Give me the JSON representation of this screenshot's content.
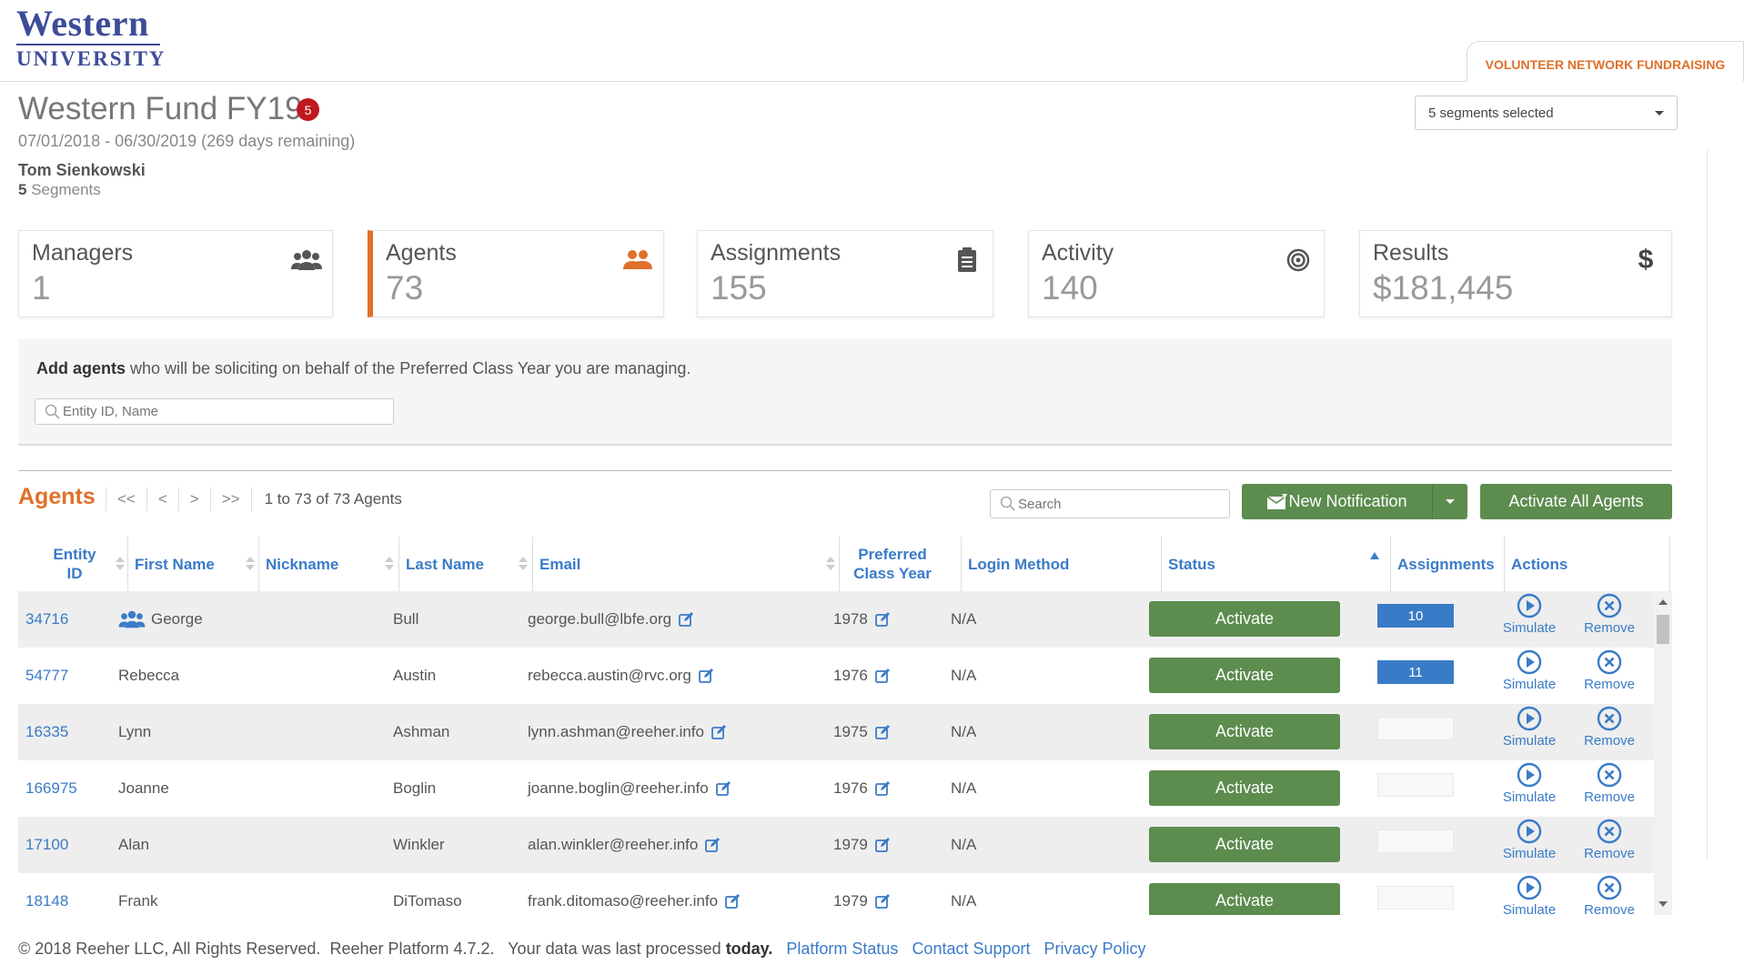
{
  "logo": {
    "top": "Western",
    "bottom": "UNIVERSITY"
  },
  "app_tab": "VOLUNTEER NETWORK FUNDRAISING",
  "fund": {
    "title": "Western Fund FY19",
    "badge": "5",
    "dates": "07/01/2018 - 06/30/2019 (269 days remaining)",
    "owner": "Tom Sienkowski",
    "segments_count": "5",
    "segments_label": "Segments"
  },
  "segments_select": {
    "value": "5 segments selected"
  },
  "cards": [
    {
      "label": "Managers",
      "value": "1",
      "icon": "managers-icon"
    },
    {
      "label": "Agents",
      "value": "73",
      "icon": "agents-icon"
    },
    {
      "label": "Assignments",
      "value": "155",
      "icon": "clipboard-icon"
    },
    {
      "label": "Activity",
      "value": "140",
      "icon": "target-icon"
    },
    {
      "label": "Results",
      "value": "$181,445",
      "icon": "dollar-icon"
    }
  ],
  "add_agents": {
    "bold": "Add agents",
    "text": " who will be soliciting on behalf of the Preferred Class Year you are managing.",
    "placeholder": "Entity ID, Name"
  },
  "agents_toolbar": {
    "title": "Agents",
    "first": "<<",
    "prev": "<",
    "next": ">",
    "last": ">>",
    "count_text": "1 to 73 of 73 Agents",
    "search_placeholder": "Search",
    "new_notification": "New Notification",
    "activate_all": "Activate All Agents"
  },
  "table": {
    "columns": {
      "entity_id_1": "Entity",
      "entity_id_2": "ID",
      "first_name": "First Name",
      "nickname": "Nickname",
      "last_name": "Last Name",
      "email": "Email",
      "pref_1": "Preferred",
      "pref_2": "Class Year",
      "login_method": "Login Method",
      "status": "Status",
      "assignments": "Assignments",
      "actions": "Actions"
    },
    "rows": [
      {
        "id": "34716",
        "first": "George",
        "nickname": "",
        "last": "Bull",
        "email": "george.bull@lbfe.org",
        "year": "1978",
        "login": "N/A",
        "status": "Activate",
        "assignments": "10",
        "filled": true,
        "manager": true,
        "simulate": "Simulate",
        "remove": "Remove"
      },
      {
        "id": "54777",
        "first": "Rebecca",
        "nickname": "",
        "last": "Austin",
        "email": "rebecca.austin@rvc.org",
        "year": "1976",
        "login": "N/A",
        "status": "Activate",
        "assignments": "11",
        "filled": true,
        "manager": false,
        "simulate": "Simulate",
        "remove": "Remove"
      },
      {
        "id": "16335",
        "first": "Lynn",
        "nickname": "",
        "last": "Ashman",
        "email": "lynn.ashman@reeher.info",
        "year": "1975",
        "login": "N/A",
        "status": "Activate",
        "assignments": "0",
        "filled": false,
        "manager": false,
        "simulate": "Simulate",
        "remove": "Remove"
      },
      {
        "id": "166975",
        "first": "Joanne",
        "nickname": "",
        "last": "Boglin",
        "email": "joanne.boglin@reeher.info",
        "year": "1976",
        "login": "N/A",
        "status": "Activate",
        "assignments": "0",
        "filled": false,
        "manager": false,
        "simulate": "Simulate",
        "remove": "Remove"
      },
      {
        "id": "17100",
        "first": "Alan",
        "nickname": "",
        "last": "Winkler",
        "email": "alan.winkler@reeher.info",
        "year": "1979",
        "login": "N/A",
        "status": "Activate",
        "assignments": "0",
        "filled": false,
        "manager": false,
        "simulate": "Simulate",
        "remove": "Remove"
      },
      {
        "id": "18148",
        "first": "Frank",
        "nickname": "",
        "last": "DiTomaso",
        "email": "frank.ditomaso@reeher.info",
        "year": "1979",
        "login": "N/A",
        "status": "Activate",
        "assignments": "0",
        "filled": false,
        "manager": false,
        "simulate": "Simulate",
        "remove": "Remove"
      }
    ]
  },
  "footer": {
    "copyright": "© 2018 Reeher LLC, All Rights Reserved.  Reeher Platform 4.7.2.   Your data was last processed ",
    "today": "today.",
    "links": [
      "Platform Status",
      "Contact Support",
      "Privacy Policy"
    ]
  },
  "colors": {
    "accent": "#e0702a",
    "link": "#3a7bc8",
    "button": "#5c8c4e",
    "badge": "#c0181f"
  }
}
